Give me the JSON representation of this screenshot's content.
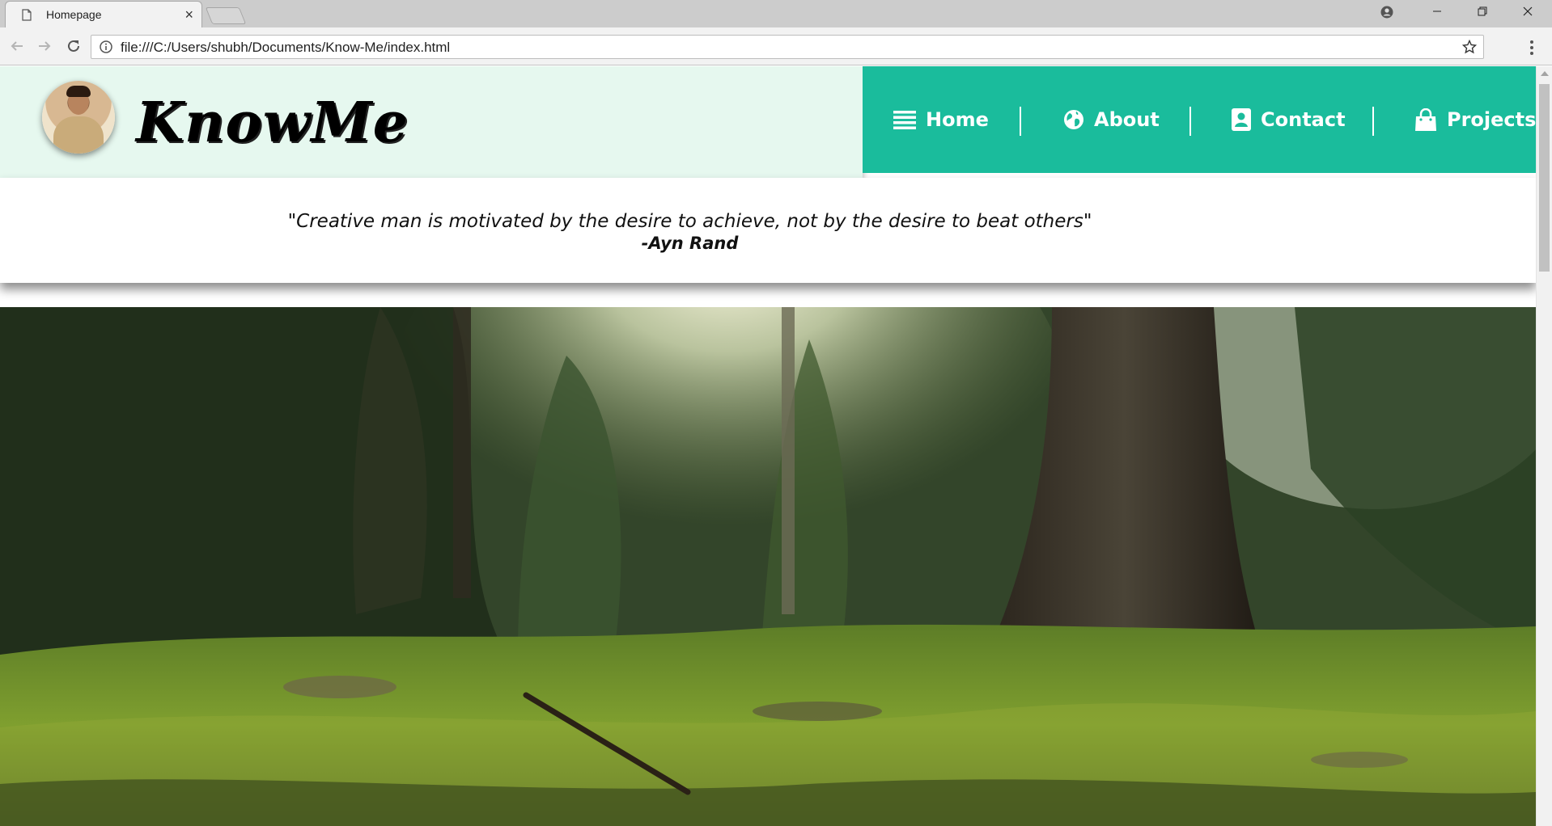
{
  "browser": {
    "tab_title": "Homepage",
    "tab_close": "×",
    "url": "file:///C:/Users/shubh/Documents/Know-Me/index.html"
  },
  "site": {
    "logo": "KnowMe",
    "nav": [
      {
        "label": "Home",
        "icon": "list-icon"
      },
      {
        "label": "About",
        "icon": "globe-icon"
      },
      {
        "label": "Contact",
        "icon": "contact-card-icon"
      },
      {
        "label": "Projects",
        "icon": "shopping-bag-icon"
      }
    ],
    "quote": {
      "text": "\"Creative man is motivated by the desire to achieve, not by the desire to beat others\"",
      "author": "-Ayn Rand"
    }
  },
  "colors": {
    "nav_background": "#1abc9c",
    "brand_background": "#e6f8ef"
  }
}
